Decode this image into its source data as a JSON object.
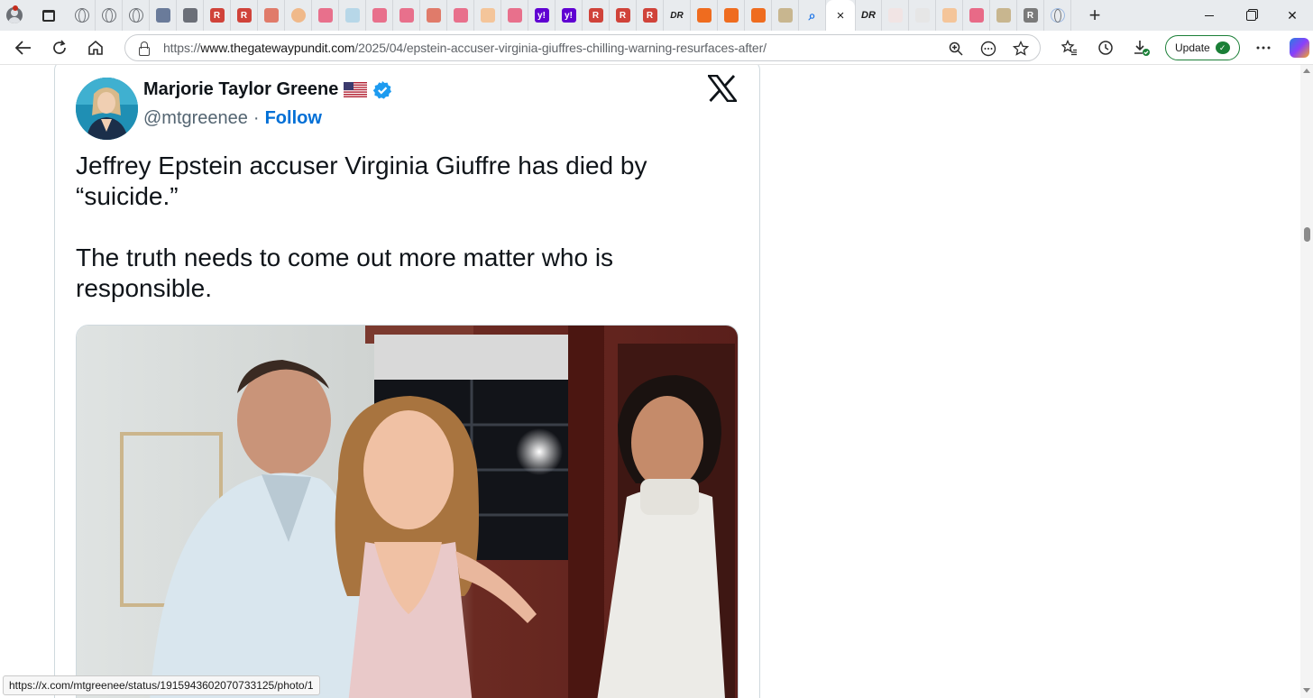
{
  "browser": {
    "tabs_icons": [
      "globe-icon",
      "globe-icon",
      "globe-icon",
      "news-icon",
      "bookmark-icon",
      "r-icon",
      "r-icon",
      "pdf-icon",
      "orange-dot-icon",
      "youtube-icon",
      "note-icon",
      "youtube-icon",
      "youtube-icon",
      "pdf-icon",
      "youtube-icon",
      "b-icon",
      "youtube-icon",
      "yahoo-icon",
      "yahoo-icon",
      "r-icon",
      "r-icon",
      "r-icon",
      "dr-icon",
      "rss-icon",
      "rss-icon",
      "rss-icon",
      "photo-icon",
      "search-icon"
    ],
    "active_tab_close": "×",
    "new_tab": "+",
    "url_prefix": "https://",
    "url_host": "www.thegatewaypundit.com",
    "url_path": "/2025/04/epstein-accuser-virginia-giuffres-chilling-warning-resurfaces-after/",
    "update_label": "Update",
    "update_badge": "✓",
    "status_url": "https://x.com/mtgreenee/status/1915943602070733125/photo/1",
    "colors": {
      "accent_green": "#1b7f37",
      "tabstrip": "#e8ebee"
    }
  },
  "tweet": {
    "author_name": "Marjorie Taylor Greene",
    "handle": "@mtgreenee",
    "separator": "·",
    "follow_label": "Follow",
    "text": "Jeffrey Epstein accuser Virginia Giuffre has died by\n“suicide.”\n\nThe truth needs to come out more matter who is\nresponsible.",
    "colors": {
      "follow": "#006fd6",
      "verified": "#1d9bf0",
      "text": "#0f1419"
    }
  }
}
